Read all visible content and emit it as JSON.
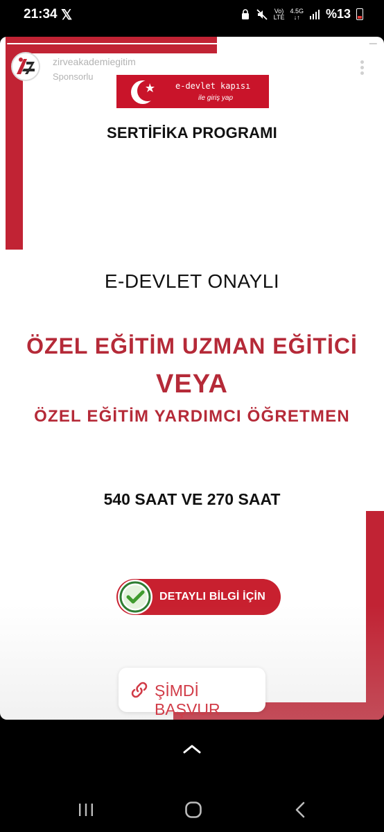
{
  "status_bar": {
    "time": "21:34",
    "x_icon": "x-logo-icon",
    "network_top": "Vo)",
    "network_bottom": "LTE",
    "network_gen": "4.5G",
    "battery_text": "%13"
  },
  "story": {
    "progress": 0.98,
    "account": {
      "username": "zirveakademiegitim",
      "sponsored_label": "Sponsorlu",
      "avatar_letters": "AZ"
    },
    "badge": {
      "title": "e-devlet kapısı",
      "subtitle": "ile giriş yap"
    },
    "program_label": "SERTİFİKA PROGRAMI",
    "approval": "E-DEVLET ONAYLI",
    "course_1": "ÖZEL EĞİTİM UZMAN EĞİTİCİ",
    "connector": "VEYA",
    "course_2": "ÖZEL EĞİTİM YARDIMCI ÖĞRETMEN",
    "hours": "540 SAAT VE 270 SAAT",
    "detail_button": "DETAYLI BİLGİ İÇİN",
    "apply_button": "ŞİMDİ BAŞVUR"
  },
  "colors": {
    "brand_red": "#c12334",
    "title_red": "#b52a38",
    "apply_text": "#d13b47"
  },
  "icons": [
    "x-logo-icon",
    "mute-icon",
    "signal-icon",
    "battery-icon",
    "more-icon",
    "check-icon",
    "link-icon",
    "chevron-up-icon",
    "recent-apps-icon",
    "home-icon",
    "back-icon"
  ]
}
